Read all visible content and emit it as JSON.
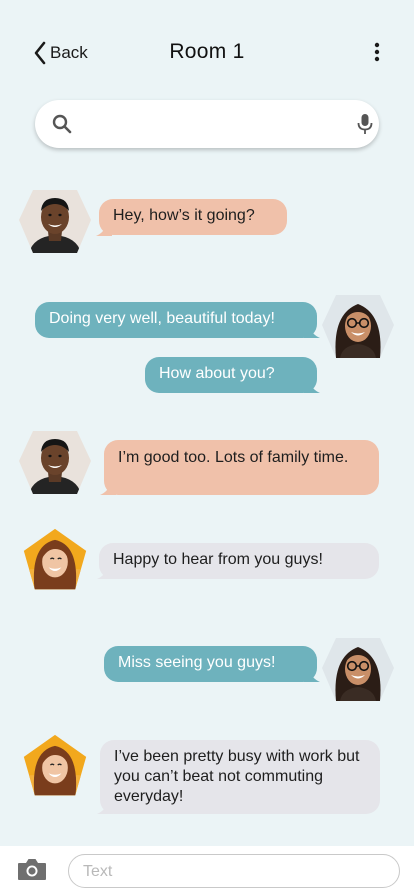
{
  "header": {
    "back_label": "Back",
    "title": "Room 1",
    "icons": {
      "back": "chevron-left-icon",
      "menu": "more-vertical-icon"
    }
  },
  "search": {
    "value": "",
    "placeholder": "",
    "icons": {
      "search": "search-icon",
      "voice": "microphone-icon"
    }
  },
  "messages": [
    {
      "sender": "man",
      "direction": "incoming",
      "text": "Hey, how’s it going?"
    },
    {
      "sender": "woman-glasses",
      "direction": "outgoing",
      "text": "Doing very well, beautiful today!"
    },
    {
      "sender": "woman-glasses",
      "direction": "outgoing",
      "text": "How about you?"
    },
    {
      "sender": "man",
      "direction": "incoming",
      "text": "I’m good too. Lots of family time."
    },
    {
      "sender": "woman-yellow",
      "direction": "incoming",
      "text": "Happy to hear from you guys!"
    },
    {
      "sender": "woman-glasses",
      "direction": "outgoing",
      "text": "Miss seeing you guys!"
    },
    {
      "sender": "woman-yellow",
      "direction": "incoming",
      "text": "I’ve been pretty busy with work but you can’t beat not commuting everyday!"
    }
  ],
  "composer": {
    "placeholder": "Text",
    "value": "",
    "icons": {
      "camera": "camera-icon"
    }
  },
  "colors": {
    "background": "#ebf4f6",
    "outgoing_bubble": "#6eb2bd",
    "incoming_bubble_man": "#f0c1aa",
    "incoming_bubble_woman": "#e5e5ea",
    "avatar_frame_yellow": "#f2a81d"
  }
}
